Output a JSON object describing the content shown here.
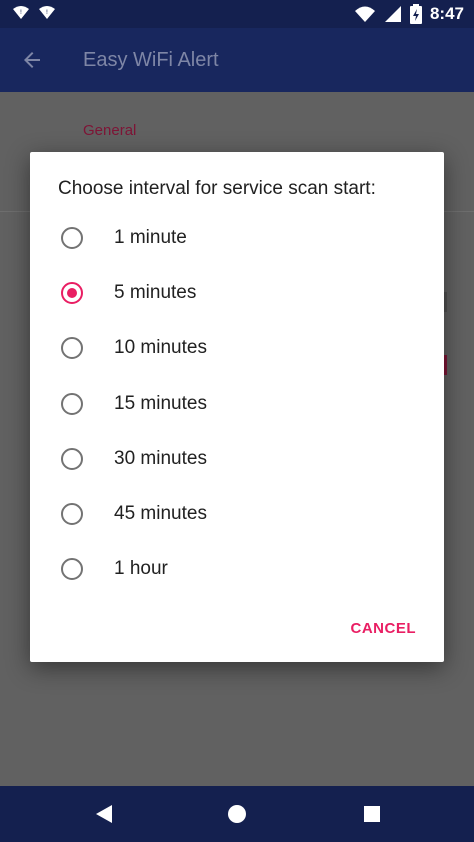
{
  "status_bar": {
    "time": "8:47",
    "icons": [
      "notification-icon-1",
      "notification-icon-2",
      "wifi-icon",
      "signal-icon",
      "battery-icon"
    ]
  },
  "app_bar": {
    "title": "Easy WiFi Alert",
    "back_icon": "arrow-back-icon"
  },
  "settings": {
    "section_header": "General"
  },
  "dialog": {
    "title": "Choose interval for service scan start:",
    "options": [
      {
        "label": "1 minute",
        "checked": false
      },
      {
        "label": "5 minutes",
        "checked": true
      },
      {
        "label": "10 minutes",
        "checked": false
      },
      {
        "label": "15 minutes",
        "checked": false
      },
      {
        "label": "30 minutes",
        "checked": false
      },
      {
        "label": "45 minutes",
        "checked": false
      },
      {
        "label": "1 hour",
        "checked": false
      }
    ],
    "cancel_label": "CANCEL"
  },
  "colors": {
    "accent": "#e91e63",
    "primary_dark": "#14204f",
    "primary": "#18275e"
  }
}
